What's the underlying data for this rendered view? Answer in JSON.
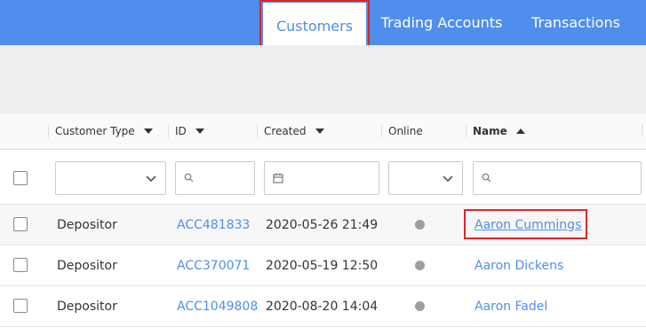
{
  "nav": {
    "tabs": [
      {
        "label": "Customers",
        "active": true
      },
      {
        "label": "Trading Accounts",
        "active": false
      },
      {
        "label": "Transactions",
        "active": false
      }
    ]
  },
  "table": {
    "columns": [
      {
        "label": "Customer Type",
        "sort": "none"
      },
      {
        "label": "ID",
        "sort": "none"
      },
      {
        "label": "Created",
        "sort": "none"
      },
      {
        "label": "Online",
        "sort": "none"
      },
      {
        "label": "Name",
        "sort": "ascending"
      }
    ],
    "rows": [
      {
        "type": "Depositor",
        "id": "ACC481833",
        "created": "2020-05-26 21:49",
        "online": "offline",
        "name": "Aaron Cummings"
      },
      {
        "type": "Depositor",
        "id": "ACC370071",
        "created": "2020-05-19 12:50",
        "online": "offline",
        "name": "Aaron Dickens"
      },
      {
        "type": "Depositor",
        "id": "ACC1049808",
        "created": "2020-08-20 14:04",
        "online": "offline",
        "name": "Aaron Fadel"
      }
    ]
  },
  "colors": {
    "nav_bg": "#4f8eec",
    "link": "#4f8eec",
    "highlight": "#d9252c",
    "offline_dot": "#9e9e9e"
  }
}
